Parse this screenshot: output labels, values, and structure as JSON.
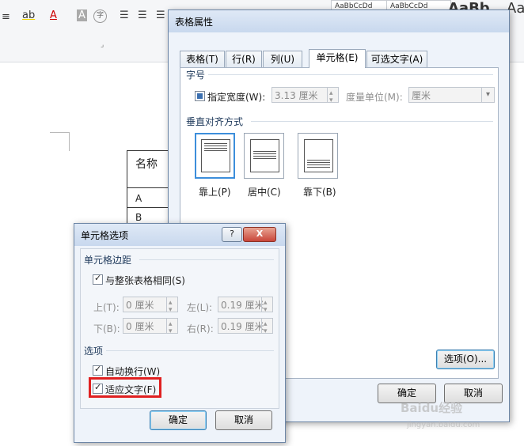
{
  "ribbon": {
    "styles": [
      "AaBbCcDd",
      "AaBbCcDd",
      "AaBb",
      "Aa"
    ],
    "font_buttons": [
      "ab",
      "A",
      "A",
      "字"
    ]
  },
  "doc": {
    "table_header": "名称",
    "rows": [
      "A",
      "B"
    ]
  },
  "table_props": {
    "title": "表格属性",
    "tabs": [
      "表格(T)",
      "行(R)",
      "列(U)",
      "单元格(E)",
      "可选文字(A)"
    ],
    "active_tab": "单元格(E)",
    "size_group": "字号",
    "specify_width_label": "指定宽度(W):",
    "specify_width_value": "3.13 厘米",
    "unit_label": "度量单位(M):",
    "unit_value": "厘米",
    "valign_group": "垂直对齐方式",
    "valign_options": [
      "靠上(P)",
      "居中(C)",
      "靠下(B)"
    ],
    "selected_valign": "靠上(P)",
    "options_button": "选项(O)...",
    "ok": "确定",
    "cancel": "取消"
  },
  "cell_options": {
    "title": "单元格选项",
    "help": "?",
    "close": "X",
    "margins_group": "单元格边距",
    "same_as_table": "与整张表格相同(S)",
    "top_label": "上(T):",
    "top_value": "0 厘米",
    "left_label": "左(L):",
    "left_value": "0.19 厘米",
    "bottom_label": "下(B):",
    "bottom_value": "0 厘米",
    "right_label": "右(R):",
    "right_value": "0.19 厘米",
    "options_group": "选项",
    "wrap_text": "自动换行(W)",
    "fit_text": "适应文字(F)",
    "ok": "确定",
    "cancel": "取消"
  },
  "watermark": {
    "text": "Baidu经验",
    "url": "jingyan.baidu.com"
  },
  "colors": {
    "highlight": "#e02020",
    "selected_border": "#3c8edb"
  }
}
